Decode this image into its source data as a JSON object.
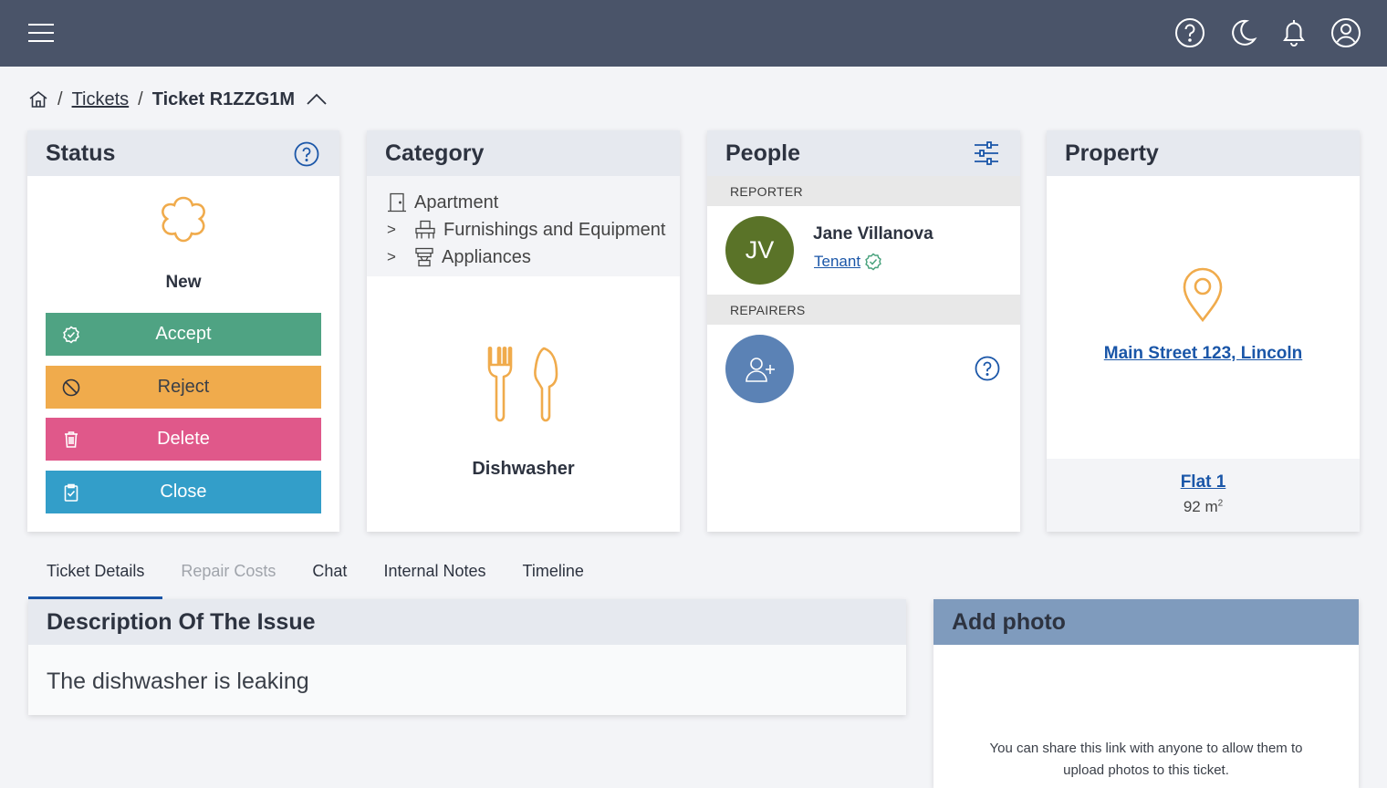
{
  "topbar": {
    "icons": [
      "menu-icon",
      "help-icon",
      "moon-icon",
      "bell-icon",
      "user-icon"
    ],
    "background": "#4a5469"
  },
  "breadcrumb": {
    "home_icon": "home-icon",
    "tickets": "Tickets",
    "current": "Ticket R1ZZG1M",
    "toggle_icon": "chevron-up-icon"
  },
  "status": {
    "title": "Status",
    "state": "New",
    "buttons": [
      {
        "label": "Accept",
        "icon": "check-badge-icon",
        "color": "#4fa383"
      },
      {
        "label": "Reject",
        "icon": "ban-icon",
        "color": "#f0ab4c"
      },
      {
        "label": "Delete",
        "icon": "trash-icon",
        "color": "#e0588a"
      },
      {
        "label": "Close",
        "icon": "clipboard-check-icon",
        "color": "#339ec9"
      }
    ],
    "state_icon_color": "#f0ab4c"
  },
  "category": {
    "title": "Category",
    "tree": [
      {
        "label": "Apartment",
        "chevron": "",
        "icon": "door-icon"
      },
      {
        "label": "Furnishings and Equipment",
        "chevron": ">",
        "icon": "furniture-icon"
      },
      {
        "label": "Appliances",
        "chevron": ">",
        "icon": "appliance-icon"
      }
    ],
    "selected": "Dishwasher",
    "selected_icon": "cutlery-icon"
  },
  "people": {
    "title": "People",
    "reporter_label": "REPORTER",
    "reporter": {
      "initials": "JV",
      "name": "Jane Villanova",
      "role": "Tenant",
      "avatar_color": "#5a7328"
    },
    "repairers_label": "REPAIRERS",
    "repairer_add_color": "#5b82b5"
  },
  "property": {
    "title": "Property",
    "address": "Main Street 123, Lincoln",
    "unit": "Flat 1",
    "area": "92 m",
    "area_sup": "2"
  },
  "tabs": [
    {
      "label": "Ticket Details",
      "state": "active"
    },
    {
      "label": "Repair Costs",
      "state": "disabled"
    },
    {
      "label": "Chat",
      "state": "normal"
    },
    {
      "label": "Internal Notes",
      "state": "normal"
    },
    {
      "label": "Timeline",
      "state": "normal"
    }
  ],
  "description": {
    "title": "Description Of The Issue",
    "text": "The dishwasher is leaking"
  },
  "photo": {
    "title": "Add photo",
    "info": "You can share this link with anyone to allow them to upload photos to this ticket."
  }
}
